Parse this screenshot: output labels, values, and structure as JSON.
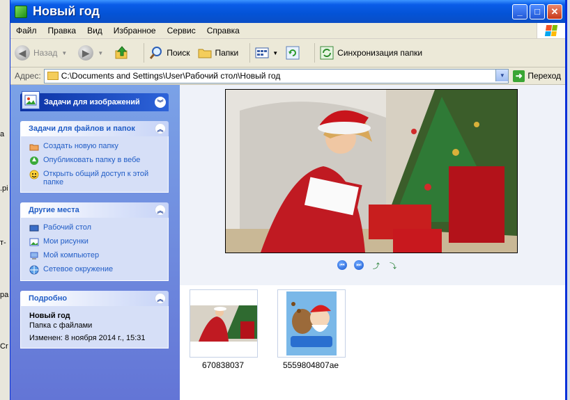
{
  "window": {
    "title": "Новый год",
    "buttons": {
      "minimize": "_",
      "maximize": "□",
      "close": "✕"
    }
  },
  "menu": [
    "Файл",
    "Правка",
    "Вид",
    "Избранное",
    "Сервис",
    "Справка"
  ],
  "toolbar": {
    "back": "Назад",
    "search": "Поиск",
    "folders": "Папки",
    "sync": "Синхронизация папки"
  },
  "address": {
    "label": "Адрес:",
    "value": "C:\\Documents and Settings\\User\\Рабочий стол\\Новый год",
    "go": "Переход"
  },
  "taskpane": {
    "image_tasks": "Задачи для изображений",
    "file_tasks": {
      "title": "Задачи для файлов и папок",
      "items": [
        "Создать новую папку",
        "Опубликовать папку в вебе",
        "Открыть общий доступ к этой папке"
      ]
    },
    "other_places": {
      "title": "Другие места",
      "items": [
        "Рабочий стол",
        "Мои рисунки",
        "Мой компьютер",
        "Сетевое окружение"
      ]
    },
    "details": {
      "title": "Подробно",
      "name": "Новый год",
      "type": "Папка с файлами",
      "modified": "Изменен: 8 ноября 2014 г., 15:31"
    }
  },
  "files": [
    {
      "name": "670838037"
    },
    {
      "name": "5559804807ae"
    }
  ],
  "colors": {
    "titlebar": "#0453d6",
    "taskpane": "#6d8be0",
    "link": "#215dc6",
    "preview_bg": "#eff2f9"
  },
  "desktop_fragments": [
    "a",
    ".pi",
    "т-",
    "ра",
    "Cr"
  ],
  "icons": [
    "back-icon",
    "forward-icon",
    "up-folder-icon",
    "search-icon",
    "folders-icon",
    "views-icon",
    "refresh-icon",
    "sync-icon",
    "folder-icon",
    "go-icon"
  ]
}
